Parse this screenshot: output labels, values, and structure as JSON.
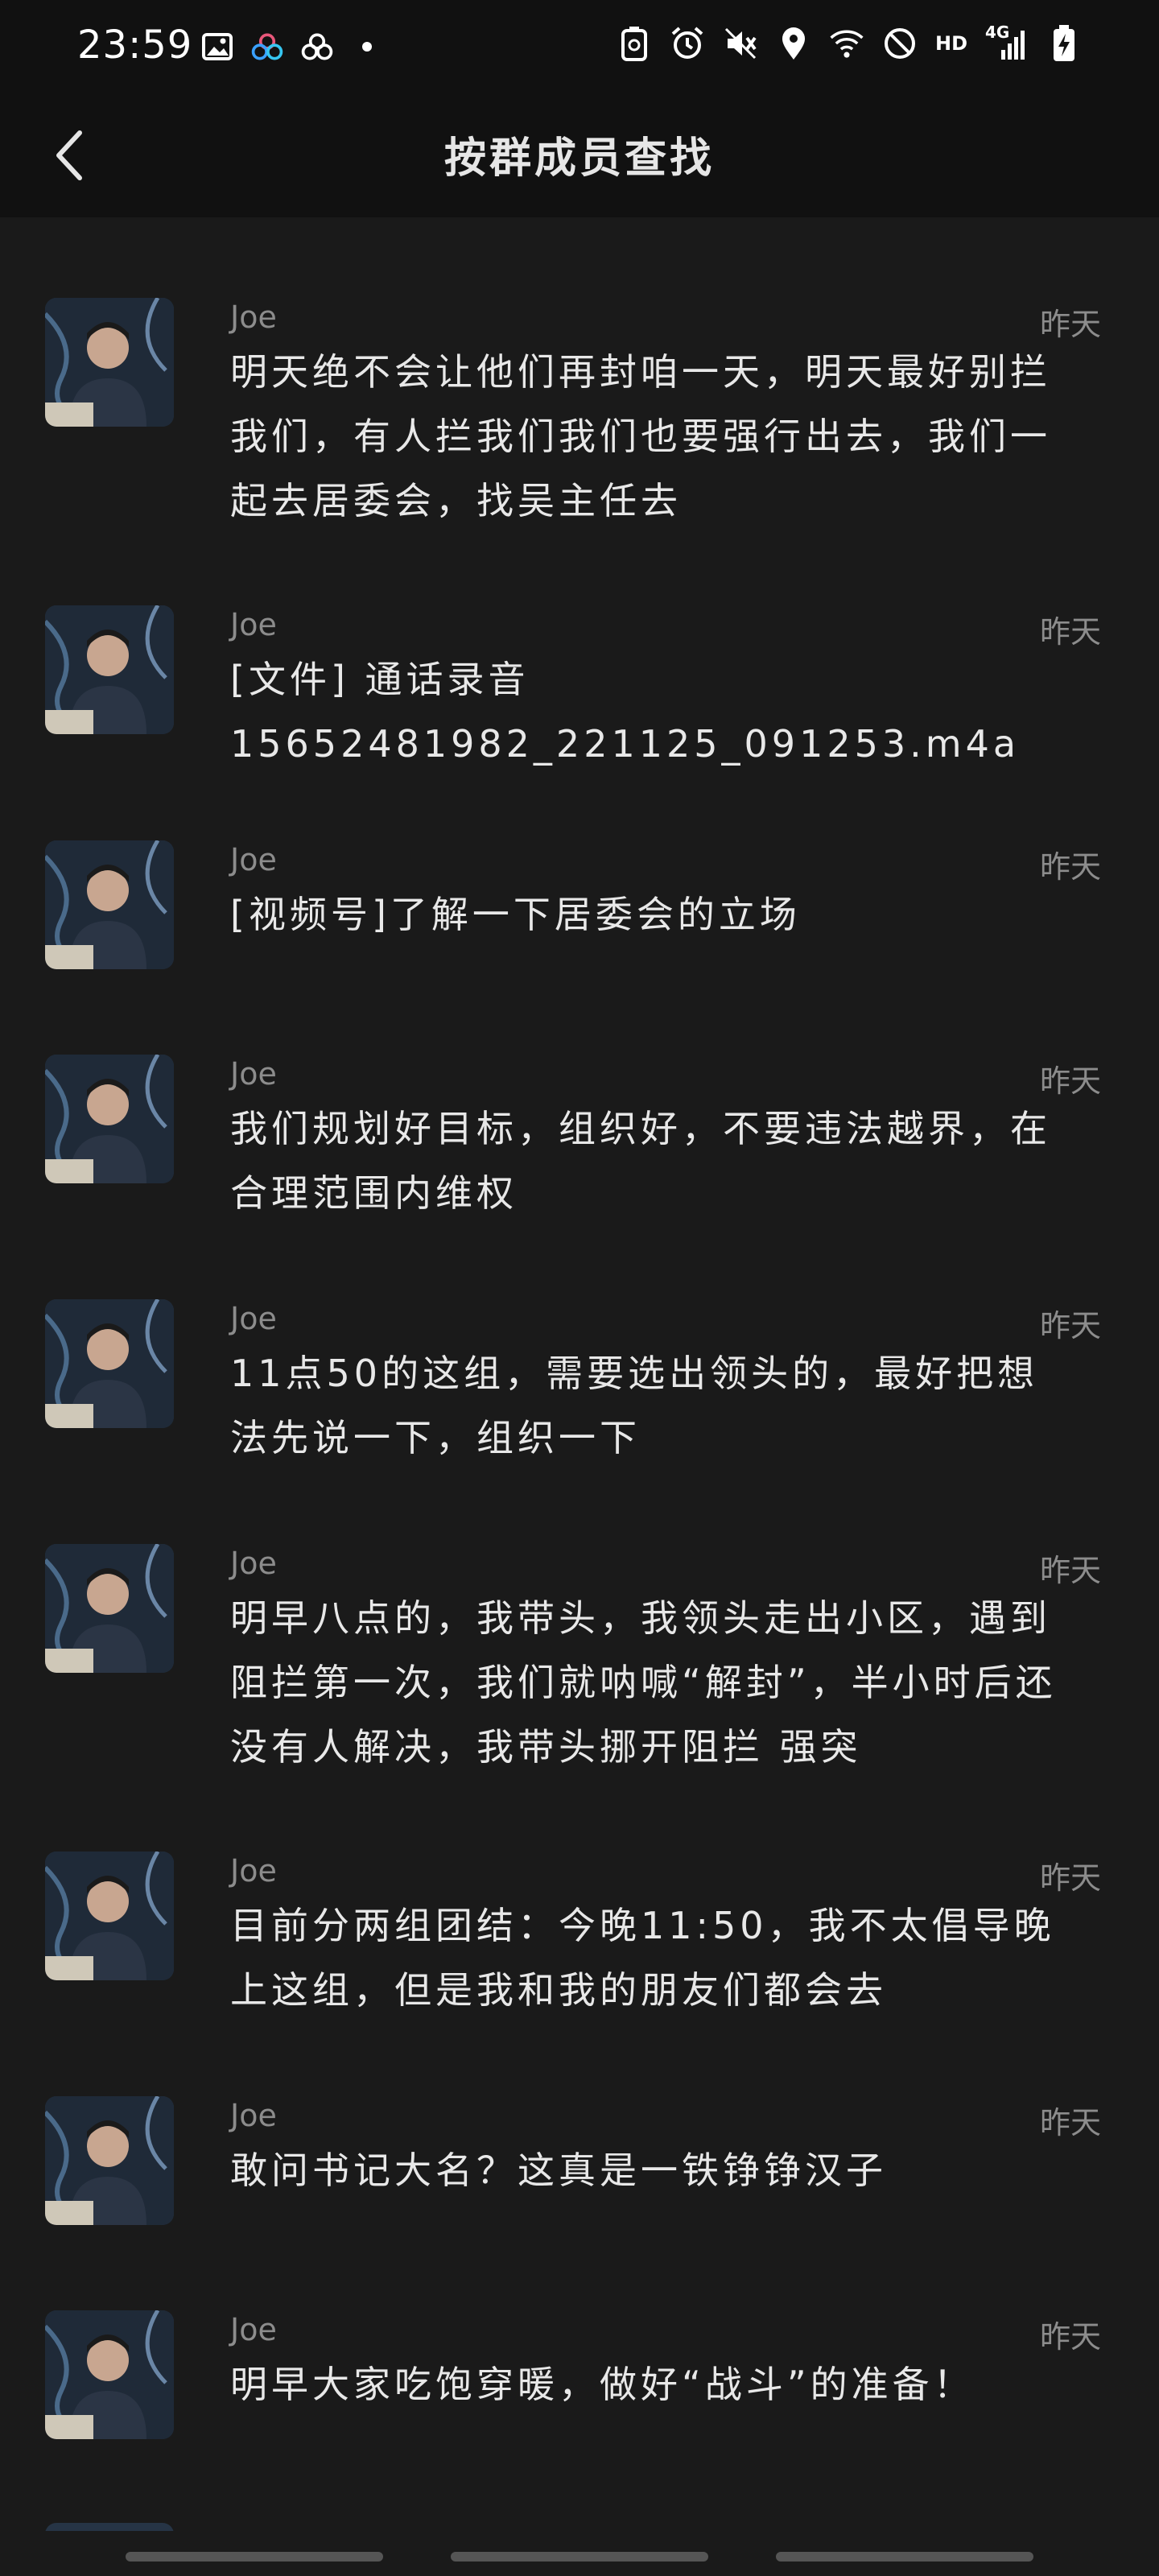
{
  "status_bar": {
    "time": "23:59",
    "hd": "HD",
    "network": "4G"
  },
  "header": {
    "title": "按群成员查找"
  },
  "messages": [
    {
      "sender": "Joe",
      "time": "昨天",
      "text": "明天绝不会让他们再封咱一天，明天最好别拦\n我们，有人拦我们我们也要强行出去，我们一\n起去居委会，找吴主任去"
    },
    {
      "sender": "Joe",
      "time": "昨天",
      "text": "[文件] 通话录音\n15652481982_221125_091253.m4a"
    },
    {
      "sender": "Joe",
      "time": "昨天",
      "text": "[视频号]了解一下居委会的立场"
    },
    {
      "sender": "Joe",
      "time": "昨天",
      "text": "我们规划好目标，组织好，不要违法越界，在\n合理范围内维权"
    },
    {
      "sender": "Joe",
      "time": "昨天",
      "text": "11点50的这组，需要选出领头的，最好把想\n法先说一下，组织一下"
    },
    {
      "sender": "Joe",
      "time": "昨天",
      "text": "明早八点的，我带头，我领头走出小区，遇到\n阻拦第一次，我们就呐喊“解封”，半小时后还\n没有人解决，我带头挪开阻拦 强突"
    },
    {
      "sender": "Joe",
      "time": "昨天",
      "text": "目前分两组团结：今晚11:50，我不太倡导晚\n上这组，但是我和我的朋友们都会去"
    },
    {
      "sender": "Joe",
      "time": "昨天",
      "text": "敢问书记大名？这真是一铁铮铮汉子"
    },
    {
      "sender": "Joe",
      "time": "昨天",
      "text": "明早大家吃饱穿暖，做好“战斗”的准备！"
    }
  ]
}
